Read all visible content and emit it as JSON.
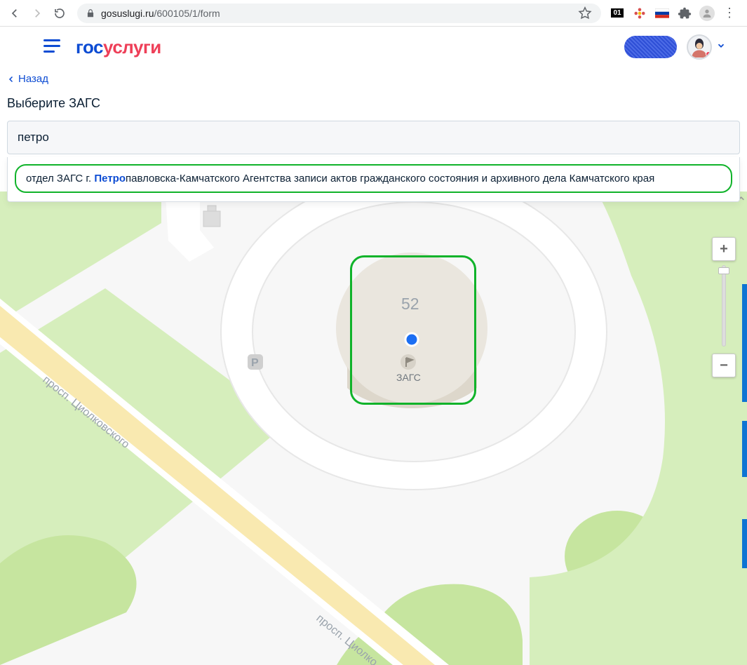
{
  "browser": {
    "url_host": "gosuslugi.ru",
    "url_path": "/600105/1/form",
    "ext_badge": "01"
  },
  "header": {
    "logo_gos": "гос",
    "logo_uslugi": "услуги"
  },
  "nav": {
    "back_label": "Назад"
  },
  "section": {
    "title": "Выберите ЗАГС"
  },
  "search": {
    "value": "петро"
  },
  "dropdown": {
    "item": {
      "prefix": "отдел ЗАГС г. ",
      "highlight": "Петро",
      "suffix": "павловска-Камчатского Агентства записи актов гражданского состояния и архивного дела Камчатского края"
    }
  },
  "map": {
    "building_number": "52",
    "building_label": "ЗАГС",
    "road_label_1": "просп. Циолковского",
    "road_label_2": "просп. Циолко",
    "parking_icon": "P"
  },
  "zoom": {
    "plus": "+",
    "minus": "−"
  }
}
